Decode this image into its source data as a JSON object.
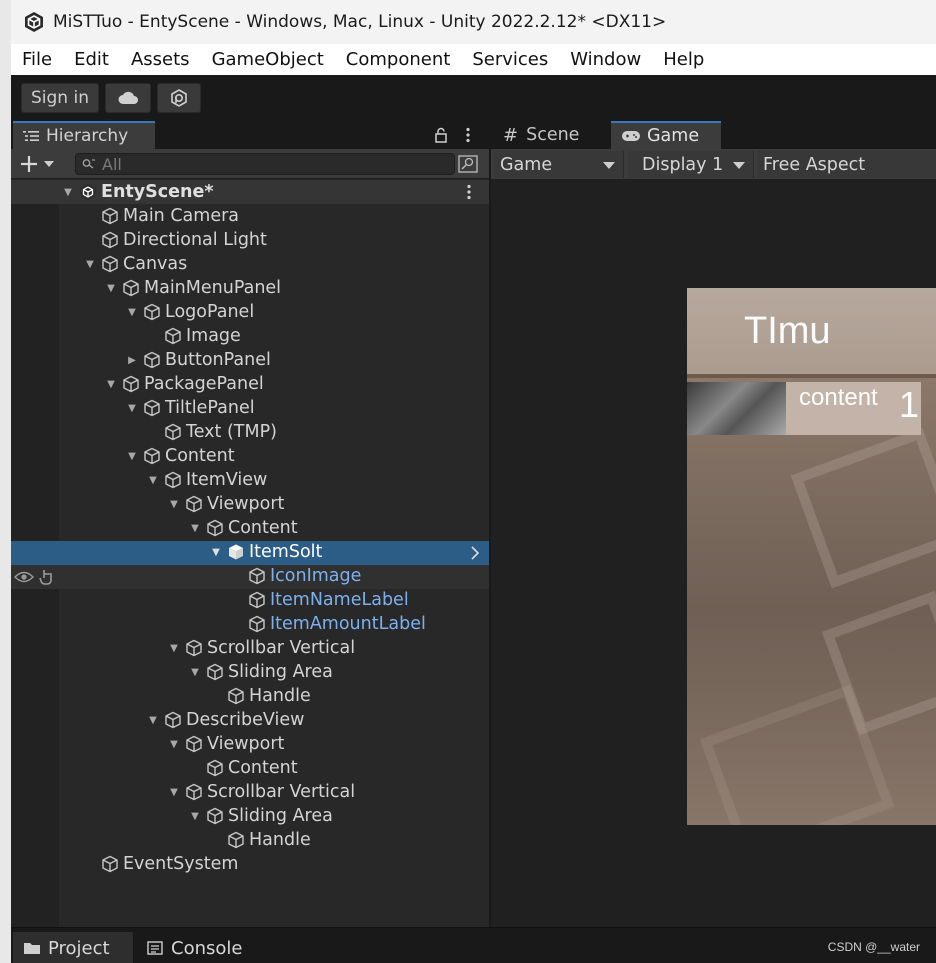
{
  "window": {
    "title": "MiSTTuo - EntyScene - Windows, Mac, Linux - Unity 2022.2.12* <DX11>"
  },
  "menu": [
    "File",
    "Edit",
    "Assets",
    "GameObject",
    "Component",
    "Services",
    "Window",
    "Help"
  ],
  "toolbar": {
    "sign_in": "Sign in"
  },
  "hierarchy": {
    "tab_label": "Hierarchy",
    "search_placeholder": "All",
    "scene_name": "EntyScene*",
    "items": [
      "Main Camera",
      "Directional Light",
      "Canvas",
      "MainMenuPanel",
      "LogoPanel",
      "Image",
      "ButtonPanel",
      "PackagePanel",
      "TiltlePanel",
      "Text (TMP)",
      "Content",
      "ItemView",
      "Viewport",
      "Content",
      "ItemSolt",
      "IconImage",
      "ItemNameLabel",
      "ItemAmountLabel",
      "Scrollbar Vertical",
      "Sliding Area",
      "Handle",
      "DescribeView",
      "Viewport",
      "Content",
      "Scrollbar Vertical",
      "Sliding Area",
      "Handle",
      "EventSystem"
    ]
  },
  "game": {
    "tabs": [
      "Scene",
      "Game"
    ],
    "view_dropdown": "Game",
    "display_dropdown": "Display 1",
    "aspect_dropdown": "Free Aspect",
    "ui_title": "TImu",
    "slot_name": "content",
    "slot_amount": "1"
  },
  "bottom": {
    "tabs": [
      "Project",
      "Console"
    ],
    "watermark": "CSDN @__water"
  },
  "colors": {
    "selection": "#2c5d87",
    "prefab_text": "#7cb1ef",
    "tab_accent": "#3a79bb"
  }
}
